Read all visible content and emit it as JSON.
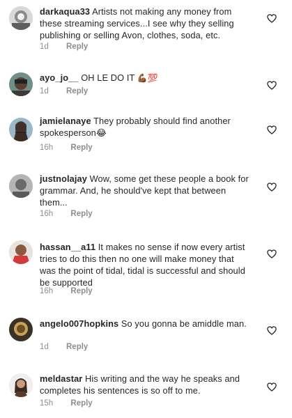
{
  "comments": [
    {
      "username": "darkaqua33",
      "text": "Artists not making any money from these streaming services...I see why they selling publishing or selling Avon, clothes, soda, etc.",
      "time": "1d",
      "reply_label": "Reply",
      "avatar_colors": [
        "#d9d9d9",
        "#7a7a7a"
      ]
    },
    {
      "username": "ayo_jo__",
      "text": "OH LE DO IT",
      "emoji": "💪🏾💯",
      "time": "1d",
      "reply_label": "Reply",
      "avatar_colors": [
        "#6f8f8a",
        "#3e3a36"
      ]
    },
    {
      "username": "jamielanaye",
      "text": "They probably should find another spokesperson😂",
      "time": "16h",
      "reply_label": "Reply",
      "avatar_colors": [
        "#9bb8c9",
        "#3b2b25"
      ]
    },
    {
      "username": "justnolajay",
      "text": "Wow, some get these people a book for grammar. And, he should've kept that between them...",
      "time": "16h",
      "reply_label": "Reply",
      "avatar_colors": [
        "#b5b5b5",
        "#5a5a5a"
      ]
    },
    {
      "username": "hassan__a11",
      "text": "It makes no sense if now every artist tries to do this then no one will make money that was the point of tidal, tidal is successful and should be supported",
      "time": "16h",
      "reply_label": "Reply",
      "avatar_colors": [
        "#d33a3a",
        "#4b3023"
      ]
    },
    {
      "username": "angelo007hopkins",
      "text": "So you gonna be amiddle man.",
      "time": "1d",
      "reply_label": "Reply",
      "avatar_colors": [
        "#3a3226",
        "#c9a25a"
      ]
    },
    {
      "username": "meldastar",
      "text": "His writing and the way he speaks and completes his sentences is so off to me.",
      "time": "15h",
      "reply_label": "Reply",
      "avatar_colors": [
        "#f1efee",
        "#3a2a22"
      ]
    }
  ]
}
